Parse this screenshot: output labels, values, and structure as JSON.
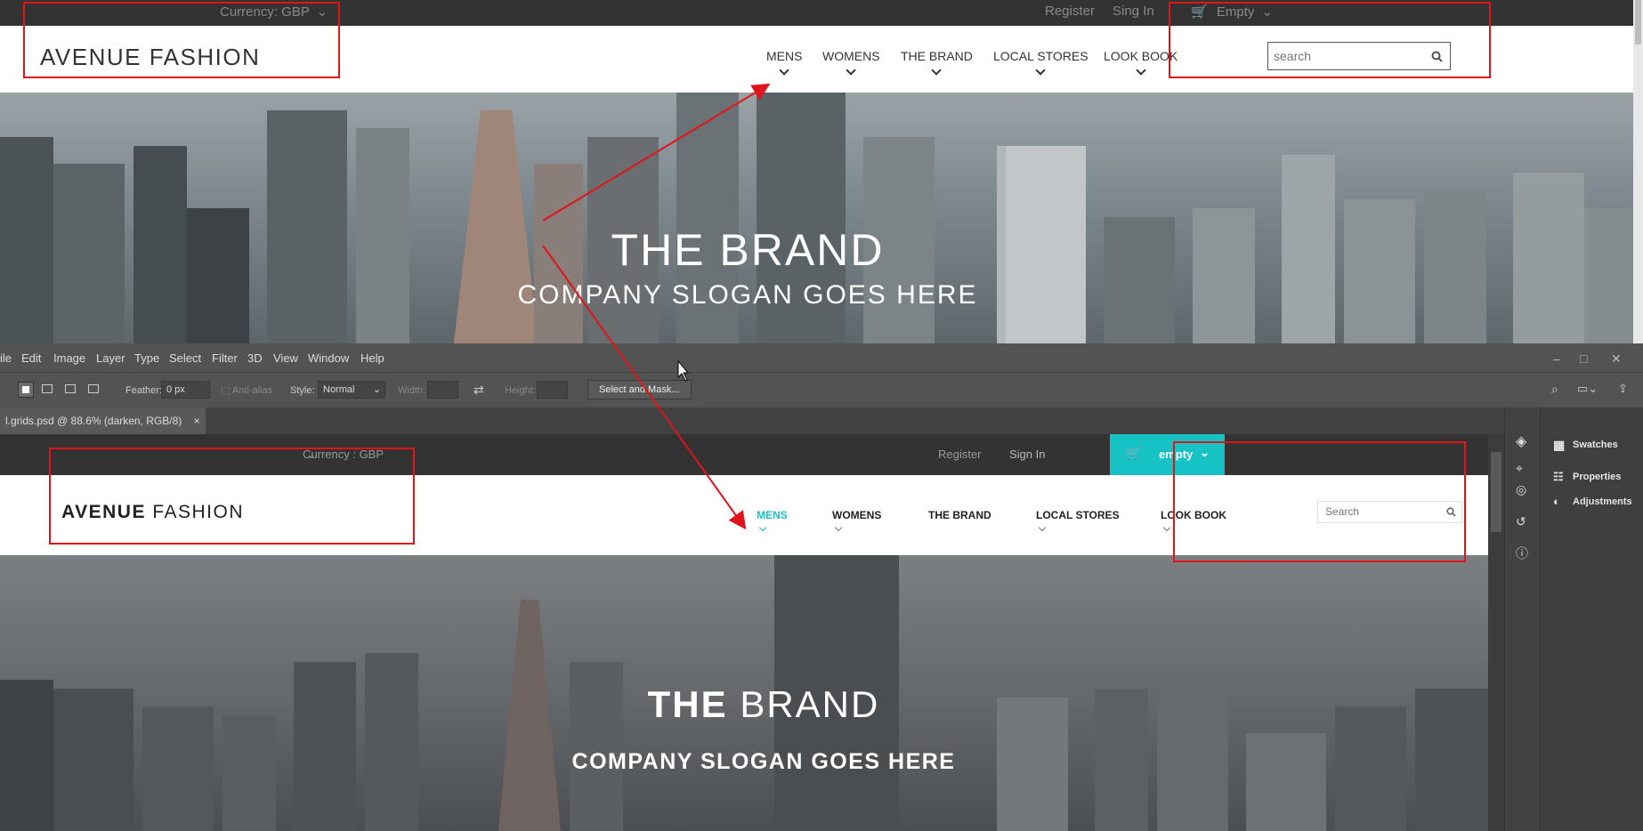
{
  "site": {
    "topbar": {
      "currency": "Currency: GBP",
      "register": "Register",
      "signin": "Sing In",
      "cart": "Empty"
    },
    "logo": "AVENUE  FASHION",
    "nav": [
      "MENS",
      "WOMENS",
      "THE BRAND",
      "LOCAL STORES",
      "LOOK BOOK"
    ],
    "search_placeholder": "search",
    "hero": {
      "title": "THE BRAND",
      "slogan": "COMPANY SLOGAN GOES HERE"
    }
  },
  "photoshop": {
    "menu": [
      "ile",
      "Edit",
      "Image",
      "Layer",
      "Type",
      "Select",
      "Filter",
      "3D",
      "View",
      "Window",
      "Help"
    ],
    "options": {
      "feather_label": "Feather:",
      "feather_value": "0 px",
      "antialias": "Anti-alias",
      "style_label": "Style:",
      "style_value": "Normal",
      "width_label": "Width:",
      "height_label": "Height:",
      "select_mask": "Select and Mask..."
    },
    "doc_tab": "l.grids.psd @ 88.6% (darken, RGB/8)",
    "panels": [
      "Swatches",
      "Properties",
      "Adjustments"
    ],
    "doc": {
      "currency": "Currency : GBP",
      "register": "Register",
      "signin": "Sign In",
      "cart": "empty",
      "logo_bold": "AVENUE",
      "logo_rest": "FASHION",
      "nav": [
        "MENS",
        "WOMENS",
        "THE BRAND",
        "LOCAL STORES",
        "LOOK BOOK"
      ],
      "search_placeholder": "Search",
      "hero_title_bold": "THE",
      "hero_title_rest": "BRAND",
      "slogan": "COMPANY SLOGAN GOES HERE"
    }
  },
  "colors": {
    "accent": "#17c2c4",
    "annotation": "#e0141b"
  }
}
